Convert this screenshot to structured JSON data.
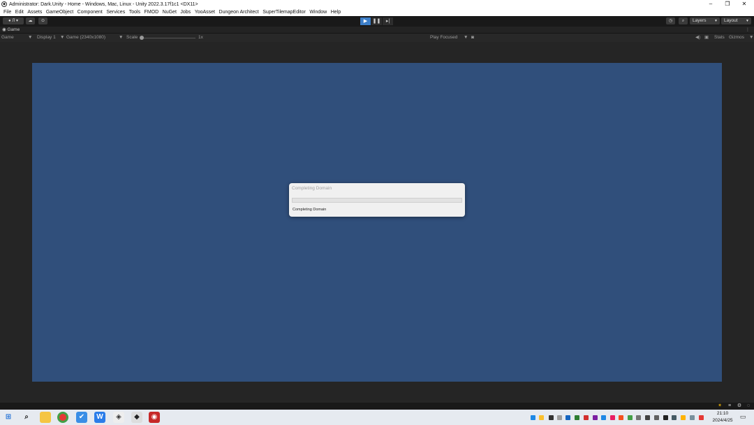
{
  "window": {
    "title": "Administrator: Dark.Unity - Home - Windows, Mac, Linux - Unity 2022.3.17f1c1 <DX11>",
    "controls": {
      "minimize": "–",
      "restore": "❐",
      "close": "✕"
    }
  },
  "menu": [
    "File",
    "Edit",
    "Assets",
    "GameObject",
    "Component",
    "Services",
    "Tools",
    "FMOD",
    "NuGet",
    "Jobs",
    "YooAsset",
    "Dungeon Architect",
    "SuperTilemapEditor",
    "Window",
    "Help"
  ],
  "toolbar": {
    "account_label": "Л",
    "layers_label": "Layers",
    "layout_label": "Layout",
    "play_controls": [
      "play",
      "pause",
      "step"
    ]
  },
  "tab": {
    "label": "Game"
  },
  "game_bar": {
    "mode": "Game",
    "display": "Display 1",
    "resolution": "Game (2340x1080)",
    "scale_label": "Scale",
    "scale_value": "1x",
    "play_mode": "Play Focused",
    "stats": "Stats",
    "gizmos": "Gizmos"
  },
  "dialog": {
    "title": "Completing Domain",
    "progress": 0,
    "message": "Completing Domain"
  },
  "taskbar": {
    "time": "21:10",
    "date": "2024/4/25"
  },
  "colors": {
    "game_view": "#304f7b",
    "play_active": "#3d7fc9"
  }
}
